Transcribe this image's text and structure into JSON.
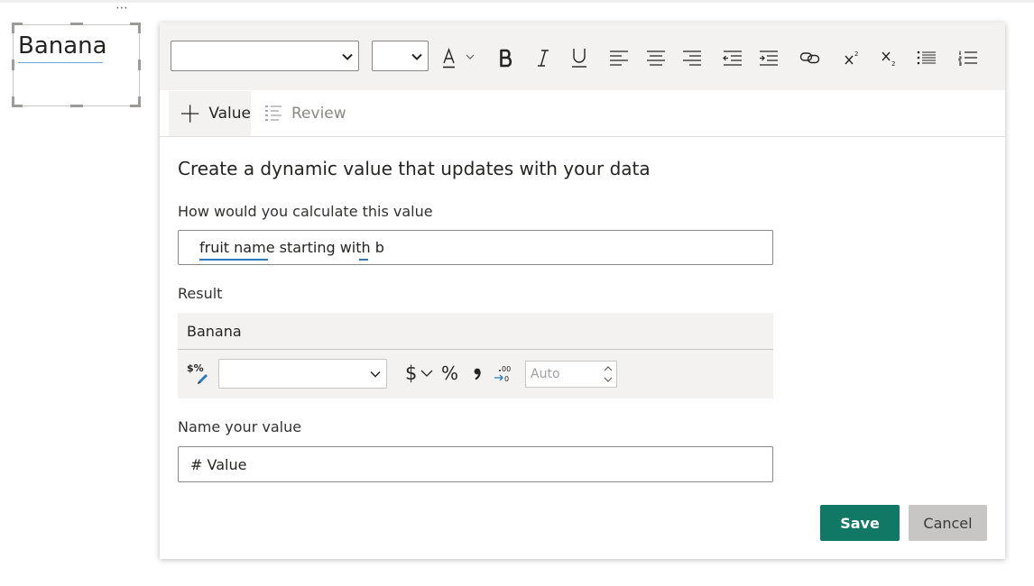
{
  "canvas": {
    "more_options": "⋯",
    "textbox_text": "Banana"
  },
  "toolbar": {
    "font_family_value": "",
    "font_size_value": "",
    "icons": [
      "font-color-icon",
      "bold-icon",
      "italic-icon",
      "underline-icon",
      "align-left-icon",
      "align-center-icon",
      "align-right-icon",
      "decrease-indent-icon",
      "increase-indent-icon",
      "link-icon",
      "superscript-icon",
      "subscript-icon",
      "bulleted-list-icon",
      "numbered-list-icon"
    ]
  },
  "tabs": [
    {
      "label": "Value",
      "icon": "plus-icon"
    },
    {
      "label": "Review",
      "icon": "list-icon"
    }
  ],
  "form": {
    "heading": "Create a dynamic value that updates with your data",
    "calc_label": "How would you calculate this value",
    "calc_value": "fruit name starting with b",
    "result_label": "Result",
    "result_value": "Banana",
    "format_value": "",
    "auto_placeholder": "Auto",
    "name_label": "Name your value",
    "name_value": "# Value"
  },
  "buttons": {
    "save": "Save",
    "cancel": "Cancel"
  },
  "colors": {
    "save_bg": "#117865",
    "cancel_bg": "#c8c6c4",
    "squiggle": "#2b79c2"
  }
}
